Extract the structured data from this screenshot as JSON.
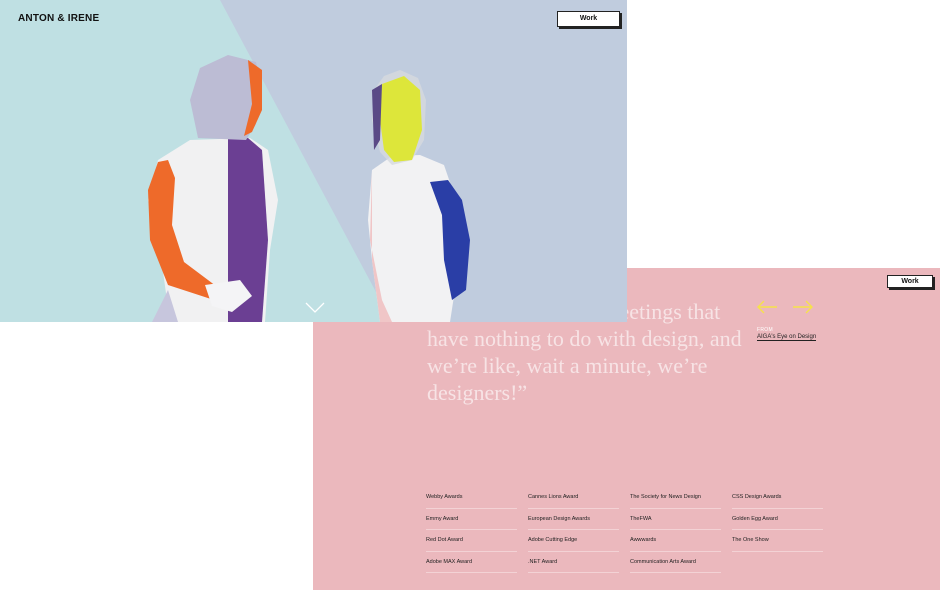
{
  "front": {
    "brand": "ANTON & IRENE",
    "work_label": "Work",
    "scroll_icon": "chevron-down-icon",
    "colors": {
      "mint": "#bfe0e3",
      "lavender": "#c0ccde"
    }
  },
  "back": {
    "work_label": "Work",
    "quote": "ave to sit in a lot of meetings that have nothing to do with design, and we’re like, wait a minute, we’re designers!”",
    "from_label": "FROM",
    "source": "AIGA's Eye on Design",
    "prev_icon": "arrow-left-icon",
    "next_icon": "arrow-right-icon",
    "colors": {
      "background": "#ebb8bd",
      "arrows": "#f6e24a"
    },
    "awards": {
      "col1": [
        "Webby Awards",
        "Emmy Award",
        "Red Dot Award",
        "Adobe MAX Award"
      ],
      "col2": [
        "Cannes Lions Award",
        "European Design Awards",
        "Adobe Cutting Edge",
        ".NET Award"
      ],
      "col3": [
        "The Society for News Design",
        "TheFWA",
        "Awwwards",
        "Communication Arts Award"
      ],
      "col4": [
        "CSS Design Awards",
        "Golden Egg Award",
        "The One Show"
      ]
    }
  }
}
